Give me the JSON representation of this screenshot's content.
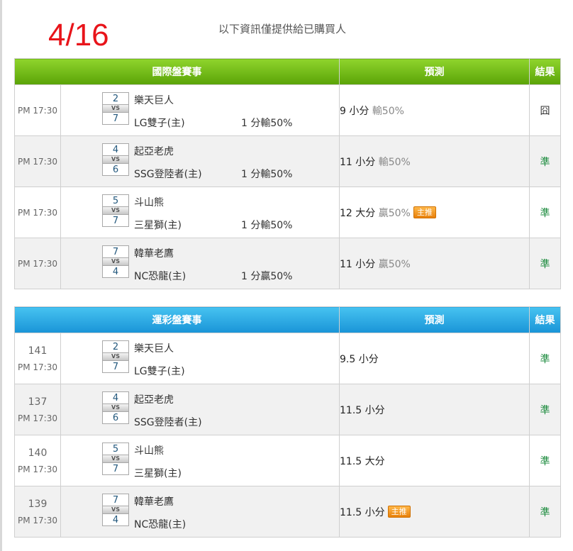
{
  "header": {
    "date": "4/16",
    "notice": "以下資訊僅提供給已購買人"
  },
  "intl": {
    "headers": {
      "event": "國際盤賽事",
      "prediction": "預測",
      "result": "結果"
    },
    "rows": [
      {
        "time": "PM 17:30",
        "score1": "2",
        "vs": "VS",
        "score2": "7",
        "team1": "樂天巨人",
        "team2": "LG雙子(主)",
        "handicap": "1 分輸50%",
        "pred": "9 小分",
        "pct": "輸50%",
        "badge": "",
        "result": "囧"
      },
      {
        "time": "PM 17:30",
        "score1": "4",
        "vs": "VS",
        "score2": "6",
        "team1": "起亞老虎",
        "team2": "SSG登陸者(主)",
        "handicap": "1 分輸50%",
        "pred": "11 小分",
        "pct": "輸50%",
        "badge": "",
        "result": "準"
      },
      {
        "time": "PM 17:30",
        "score1": "5",
        "vs": "VS",
        "score2": "7",
        "team1": "斗山熊",
        "team2": "三星獅(主)",
        "handicap": "1 分輸50%",
        "pred": "12 大分",
        "pct": "贏50%",
        "badge": "主推",
        "result": "準"
      },
      {
        "time": "PM 17:30",
        "score1": "7",
        "vs": "VS",
        "score2": "4",
        "team1": "韓華老鷹",
        "team2": "NC恐龍(主)",
        "handicap": "1 分贏50%",
        "pred": "11 小分",
        "pct": "贏50%",
        "badge": "",
        "result": "準"
      }
    ]
  },
  "sports": {
    "headers": {
      "event": "運彩盤賽事",
      "prediction": "預測",
      "result": "結果"
    },
    "rows": [
      {
        "num": "141",
        "time": "PM 17:30",
        "score1": "2",
        "vs": "VS",
        "score2": "7",
        "team1": "樂天巨人",
        "team2": "LG雙子(主)",
        "pred": "9.5 小分",
        "badge": "",
        "result": "準"
      },
      {
        "num": "137",
        "time": "PM 17:30",
        "score1": "4",
        "vs": "VS",
        "score2": "6",
        "team1": "起亞老虎",
        "team2": "SSG登陸者(主)",
        "pred": "11.5 小分",
        "badge": "",
        "result": "準"
      },
      {
        "num": "140",
        "time": "PM 17:30",
        "score1": "5",
        "vs": "VS",
        "score2": "7",
        "team1": "斗山熊",
        "team2": "三星獅(主)",
        "pred": "11.5 大分",
        "badge": "",
        "result": "準"
      },
      {
        "num": "139",
        "time": "PM 17:30",
        "score1": "7",
        "vs": "VS",
        "score2": "4",
        "team1": "韓華老鷹",
        "team2": "NC恐龍(主)",
        "pred": "11.5 小分",
        "badge": "主推",
        "result": "準"
      }
    ]
  }
}
